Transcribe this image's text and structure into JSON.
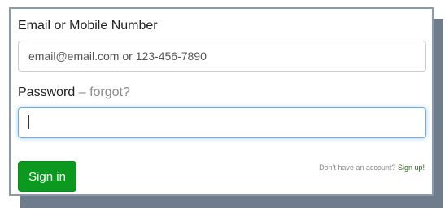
{
  "login": {
    "email_label": "Email or Mobile Number",
    "email_placeholder": "email@email.com or 123-456-7890",
    "password_label": "Password",
    "dash": "–",
    "forgot_link": "forgot?",
    "password_value": "",
    "signin_button": "Sign in",
    "account_text": "Don't have an account?",
    "signup_link": "Sign up!"
  },
  "colors": {
    "button_bg": "#0b9a1f",
    "focus_border": "#66afe9",
    "panel_border": "#8a99ad",
    "shadow": "#6f7c8c"
  }
}
